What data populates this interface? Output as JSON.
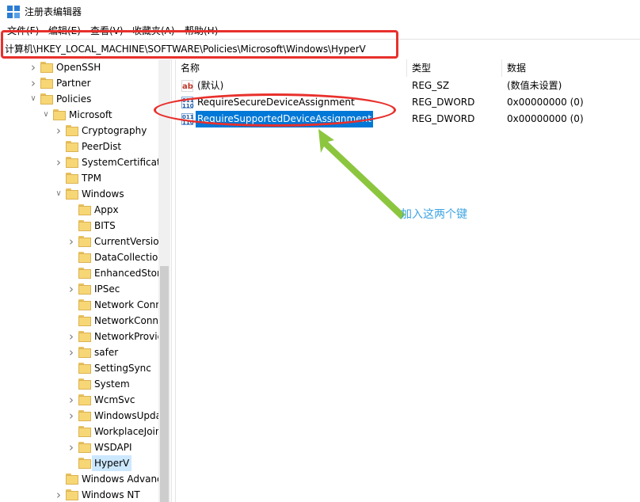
{
  "window": {
    "title": "注册表编辑器"
  },
  "menu": [
    {
      "label": "文件(F)"
    },
    {
      "label": "编辑(E)"
    },
    {
      "label": "查看(V)"
    },
    {
      "label": "收藏夹(A)"
    },
    {
      "label": "帮助(H)"
    }
  ],
  "address": {
    "path": "计算机\\HKEY_LOCAL_MACHINE\\SOFTWARE\\Policies\\Microsoft\\Windows\\HyperV"
  },
  "tree": {
    "items": [
      {
        "label": "OpenSSH",
        "level": 1,
        "chevron": "right"
      },
      {
        "label": "Partner",
        "level": 1,
        "chevron": "right"
      },
      {
        "label": "Policies",
        "level": 1,
        "chevron": "down"
      },
      {
        "label": "Microsoft",
        "level": 2,
        "chevron": "down"
      },
      {
        "label": "Cryptography",
        "level": 3,
        "chevron": "right"
      },
      {
        "label": "PeerDist",
        "level": 3,
        "chevron": ""
      },
      {
        "label": "SystemCertificates",
        "level": 3,
        "chevron": "right"
      },
      {
        "label": "TPM",
        "level": 3,
        "chevron": ""
      },
      {
        "label": "Windows",
        "level": 3,
        "chevron": "down"
      },
      {
        "label": "Appx",
        "level": 4,
        "chevron": ""
      },
      {
        "label": "BITS",
        "level": 4,
        "chevron": ""
      },
      {
        "label": "CurrentVersion",
        "level": 4,
        "chevron": "right"
      },
      {
        "label": "DataCollection",
        "level": 4,
        "chevron": ""
      },
      {
        "label": "EnhancedStorage",
        "level": 4,
        "chevron": ""
      },
      {
        "label": "IPSec",
        "level": 4,
        "chevron": "right"
      },
      {
        "label": "Network Connections",
        "level": 4,
        "chevron": ""
      },
      {
        "label": "NetworkConnectivityStatusIndicator",
        "level": 4,
        "chevron": ""
      },
      {
        "label": "NetworkProvider",
        "level": 4,
        "chevron": "right"
      },
      {
        "label": "safer",
        "level": 4,
        "chevron": "right"
      },
      {
        "label": "SettingSync",
        "level": 4,
        "chevron": ""
      },
      {
        "label": "System",
        "level": 4,
        "chevron": ""
      },
      {
        "label": "WcmSvc",
        "level": 4,
        "chevron": "right"
      },
      {
        "label": "WindowsUpdate",
        "level": 4,
        "chevron": "right"
      },
      {
        "label": "WorkplaceJoin",
        "level": 4,
        "chevron": ""
      },
      {
        "label": "WSDAPI",
        "level": 4,
        "chevron": "right"
      },
      {
        "label": "HyperV",
        "level": 4,
        "chevron": "",
        "selected": true
      },
      {
        "label": "Windows Advanced Threat Protection",
        "level": 3,
        "chevron": ""
      },
      {
        "label": "Windows NT",
        "level": 3,
        "chevron": "right"
      }
    ]
  },
  "columns": {
    "name": "名称",
    "type": "类型",
    "data": "数据"
  },
  "values": [
    {
      "icon": "ab",
      "name": "(默认)",
      "type": "REG_SZ",
      "data": "(数值未设置)",
      "selected": false
    },
    {
      "icon": "bin",
      "name": "RequireSecureDeviceAssignment",
      "type": "REG_DWORD",
      "data": "0x00000000 (0)",
      "selected": false
    },
    {
      "icon": "bin",
      "name": "RequireSupportedDeviceAssignment",
      "type": "REG_DWORD",
      "data": "0x00000000 (0)",
      "selected": true
    }
  ],
  "annotation": {
    "text": "加入这两个键",
    "color": "#3ea5e4"
  },
  "colors": {
    "highlight_red": "#e8302c",
    "arrow_green": "#8cc63f",
    "selection_blue": "#0078d7"
  }
}
